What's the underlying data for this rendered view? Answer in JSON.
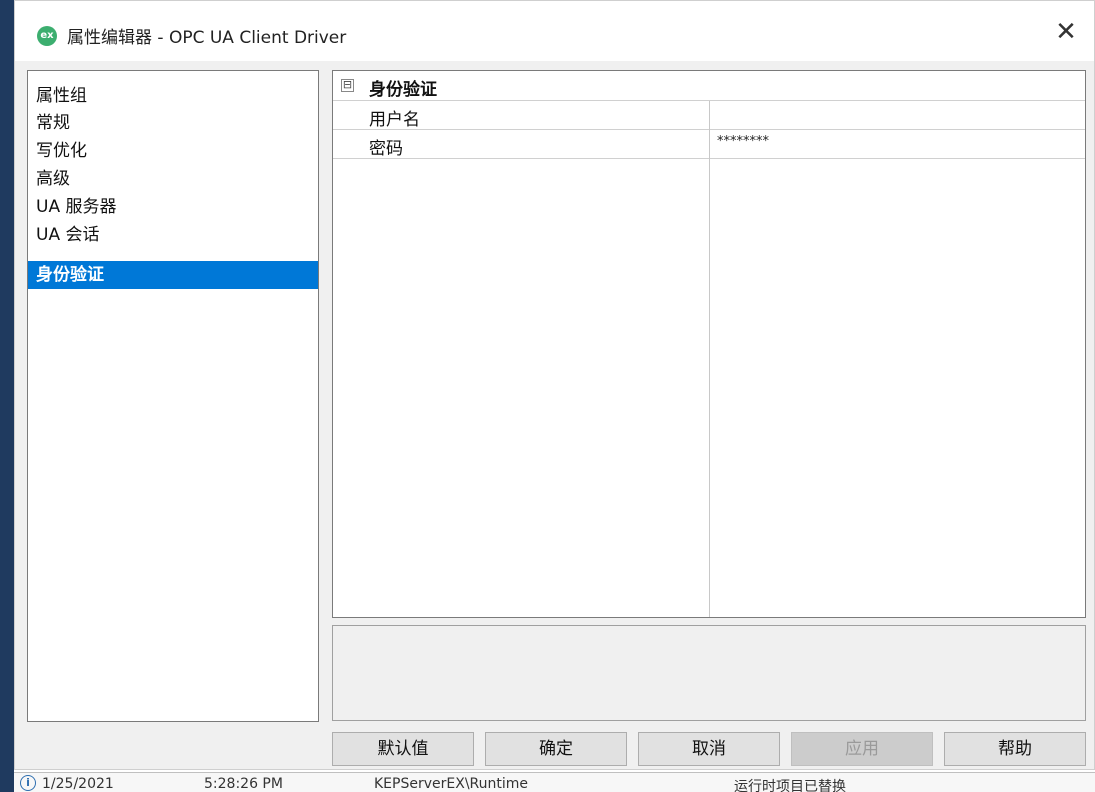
{
  "window": {
    "title": "属性编辑器 - OPC UA Client Driver",
    "icon": "ex-app-icon",
    "close_glyph": "✕"
  },
  "property_groups": {
    "header": "属性组",
    "items": [
      {
        "label": "常规",
        "selected": false
      },
      {
        "label": "写优化",
        "selected": false
      },
      {
        "label": "高级",
        "selected": false
      },
      {
        "label": "UA 服务器",
        "selected": false
      },
      {
        "label": "UA 会话",
        "selected": false
      },
      {
        "label": "身份验证",
        "selected": true
      }
    ]
  },
  "property_grid": {
    "category": {
      "label": "身份验证",
      "toggle": "⊟"
    },
    "rows": [
      {
        "name": "用户名",
        "value": ""
      },
      {
        "name": "密码",
        "value": "********"
      }
    ]
  },
  "buttons": {
    "default": "默认值",
    "ok": "确定",
    "cancel": "取消",
    "apply": "应用",
    "help": "帮助"
  },
  "status_bar": {
    "icon": "i",
    "date": "1/25/2021",
    "time": "5:28:26 PM",
    "source": "KEPServerEX\\Runtime",
    "message": "运行时项目已替换"
  },
  "colors": {
    "selection": "#0078d7",
    "app_icon": "#3cae6f",
    "background_strip": "#1f3a5f"
  }
}
